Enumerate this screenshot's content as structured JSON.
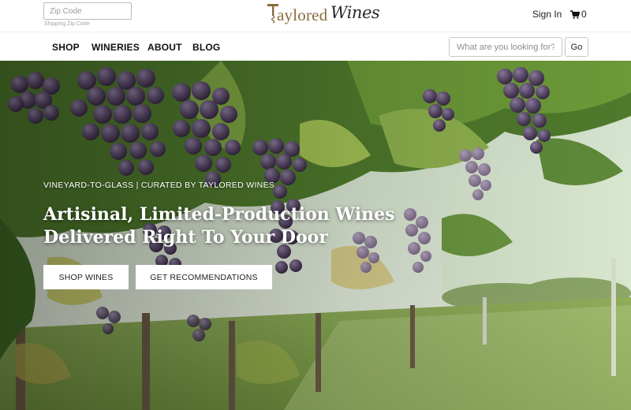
{
  "header": {
    "zip_placeholder": "Zip Code",
    "zip_hint": "Shipping Zip Code",
    "logo": {
      "part1": "aylored",
      "part2": "Wines",
      "initial": "T"
    },
    "signin_label": "Sign In",
    "cart_count": "0",
    "cart_icon": "shopping-cart-icon"
  },
  "nav": {
    "items": [
      {
        "label": "SHOP"
      },
      {
        "label": "WINERIES"
      },
      {
        "label": "ABOUT"
      },
      {
        "label": "BLOG"
      }
    ],
    "search_placeholder": "What are you looking for?",
    "search_button": "Go"
  },
  "hero": {
    "kicker": "VINEYARD-TO-GLASS | CURATED BY TAYLORED WINES",
    "title_line1": "Artisinal, Limited-Production Wines",
    "title_line2": "Delivered Right To Your Door",
    "primary_button": "SHOP WINES",
    "secondary_button": "GET RECOMMENDATIONS"
  },
  "colors": {
    "logo_gold": "#8a6b3e",
    "grape_purple": "#5b4a6a",
    "leaf_green": "#5f8a3a"
  }
}
